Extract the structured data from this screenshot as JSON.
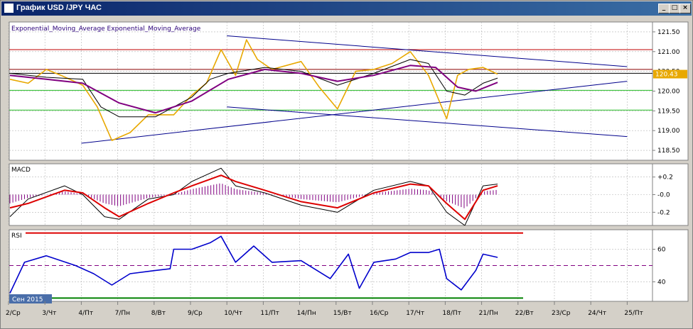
{
  "window": {
    "title": "График USD /JPY ЧАС",
    "minimize_glyph": "_",
    "maximize_glyph": "□",
    "close_glyph": "×"
  },
  "chart_data": [
    {
      "panel": "price",
      "type": "line",
      "legend_text": "Exponential_Moving_Average Exponential_Moving_Average",
      "y_ticks": [
        "121.50",
        "121.00",
        "120.50",
        "120.00",
        "119.50",
        "119.00",
        "118.50"
      ],
      "y_tick_values": [
        121.5,
        121.0,
        120.5,
        120.0,
        119.5,
        119.0,
        118.5
      ],
      "ylim": [
        118.25,
        121.75
      ],
      "current_price": "120.43",
      "x_ticks": [
        "2/Ср",
        "3/Чт",
        "4/Пт",
        "7/Пн",
        "8/Вт",
        "9/Ср",
        "10/Чт",
        "11/Пт",
        "14/Пн",
        "15/Вт",
        "16/Ср",
        "17/Чт",
        "18/Пт",
        "21/Пн",
        "22/Вт",
        "23/Ср",
        "24/Чт",
        "25/Пт"
      ],
      "date_badge": "Сен 2015",
      "horizontal_lines": [
        {
          "value": 121.05,
          "color": "#c00000"
        },
        {
          "value": 120.55,
          "color": "#8b0000"
        },
        {
          "value": 120.45,
          "color": "#000000"
        },
        {
          "value": 120.02,
          "color": "#22bb22"
        },
        {
          "value": 119.52,
          "color": "#22bb22"
        }
      ],
      "trend_lines": [
        {
          "from": [
            "10/Чт",
            121.4
          ],
          "to": [
            "25/Пт",
            120.62
          ],
          "color": "#00008b"
        },
        {
          "from": [
            "4/Пт",
            118.68
          ],
          "to": [
            "25/Пт",
            120.25
          ],
          "color": "#00008b"
        },
        {
          "from": [
            "10/Чт",
            119.6
          ],
          "to": [
            "25/Пт",
            118.85
          ],
          "color": "#00008b"
        }
      ],
      "series": [
        {
          "color": "#e8a800",
          "points": [
            [
              0,
              120.3
            ],
            [
              0.5,
              120.2
            ],
            [
              1,
              120.55
            ],
            [
              1.4,
              120.4
            ],
            [
              2,
              120.15
            ],
            [
              2.4,
              119.6
            ],
            [
              2.8,
              118.75
            ],
            [
              3.3,
              118.95
            ],
            [
              3.8,
              119.4
            ],
            [
              4.5,
              119.4
            ],
            [
              5,
              119.9
            ],
            [
              5.4,
              120.2
            ],
            [
              5.8,
              121.05
            ],
            [
              6.2,
              120.4
            ],
            [
              6.5,
              121.3
            ],
            [
              6.8,
              120.8
            ],
            [
              7.2,
              120.55
            ],
            [
              8,
              120.75
            ],
            [
              8.5,
              120.1
            ],
            [
              9,
              119.55
            ],
            [
              9.5,
              120.5
            ],
            [
              10,
              120.55
            ],
            [
              10.5,
              120.7
            ],
            [
              11,
              121.0
            ],
            [
              11.5,
              120.4
            ],
            [
              12,
              119.3
            ],
            [
              12.3,
              120.4
            ],
            [
              12.6,
              120.55
            ],
            [
              13,
              120.6
            ],
            [
              13.4,
              120.43
            ]
          ]
        },
        {
          "color": "#000000",
          "points": [
            [
              0,
              120.45
            ],
            [
              1,
              120.35
            ],
            [
              2,
              120.3
            ],
            [
              2.5,
              119.6
            ],
            [
              3,
              119.35
            ],
            [
              4,
              119.35
            ],
            [
              5,
              119.85
            ],
            [
              5.5,
              120.3
            ],
            [
              6,
              120.45
            ],
            [
              7,
              120.6
            ],
            [
              8,
              120.5
            ],
            [
              9,
              120.15
            ],
            [
              10,
              120.45
            ],
            [
              11,
              120.8
            ],
            [
              11.5,
              120.7
            ],
            [
              12,
              120.0
            ],
            [
              12.5,
              119.9
            ],
            [
              13,
              120.2
            ],
            [
              13.4,
              120.33
            ]
          ]
        },
        {
          "color": "#800080",
          "points": [
            [
              0,
              120.4
            ],
            [
              1,
              120.3
            ],
            [
              2,
              120.2
            ],
            [
              3,
              119.7
            ],
            [
              4,
              119.45
            ],
            [
              5,
              119.75
            ],
            [
              6,
              120.3
            ],
            [
              7,
              120.55
            ],
            [
              8,
              120.45
            ],
            [
              9,
              120.25
            ],
            [
              10,
              120.4
            ],
            [
              11,
              120.65
            ],
            [
              11.7,
              120.6
            ],
            [
              12.3,
              120.1
            ],
            [
              12.8,
              120.0
            ],
            [
              13.4,
              120.22
            ]
          ]
        }
      ]
    },
    {
      "panel": "macd",
      "type": "line",
      "label": "MACD",
      "y_ticks": [
        "+0.2",
        "-0.0",
        "-0.2"
      ],
      "y_tick_values": [
        0.2,
        0.0,
        -0.2
      ],
      "ylim": [
        -0.35,
        0.35
      ],
      "series": [
        {
          "color": "#000000",
          "points": [
            [
              0,
              -0.25
            ],
            [
              0.5,
              -0.05
            ],
            [
              1.5,
              0.1
            ],
            [
              2,
              0.0
            ],
            [
              2.6,
              -0.25
            ],
            [
              3,
              -0.28
            ],
            [
              3.8,
              -0.05
            ],
            [
              4.5,
              0.0
            ],
            [
              5,
              0.15
            ],
            [
              5.8,
              0.3
            ],
            [
              6.2,
              0.1
            ],
            [
              7,
              0.02
            ],
            [
              8,
              -0.12
            ],
            [
              9,
              -0.2
            ],
            [
              10,
              0.05
            ],
            [
              11,
              0.15
            ],
            [
              11.5,
              0.1
            ],
            [
              12,
              -0.2
            ],
            [
              12.5,
              -0.35
            ],
            [
              13,
              0.1
            ],
            [
              13.4,
              0.12
            ]
          ]
        },
        {
          "color": "#dd0000",
          "points": [
            [
              0,
              -0.15
            ],
            [
              0.5,
              -0.1
            ],
            [
              1.5,
              0.05
            ],
            [
              2,
              0.02
            ],
            [
              2.6,
              -0.15
            ],
            [
              3,
              -0.25
            ],
            [
              3.8,
              -0.1
            ],
            [
              4.5,
              0.02
            ],
            [
              5,
              0.1
            ],
            [
              5.8,
              0.22
            ],
            [
              6.2,
              0.15
            ],
            [
              7,
              0.05
            ],
            [
              8,
              -0.08
            ],
            [
              9,
              -0.15
            ],
            [
              10,
              0.02
            ],
            [
              11,
              0.12
            ],
            [
              11.5,
              0.1
            ],
            [
              12,
              -0.1
            ],
            [
              12.5,
              -0.28
            ],
            [
              13,
              0.05
            ],
            [
              13.4,
              0.1
            ]
          ]
        }
      ]
    },
    {
      "panel": "rsi",
      "type": "line",
      "label": "RSI",
      "y_ticks": [
        "60",
        "40"
      ],
      "y_tick_values": [
        60,
        40
      ],
      "ylim": [
        28,
        72
      ],
      "levels": [
        {
          "value": 70,
          "color": "#dd0000"
        },
        {
          "value": 50,
          "color": "#800080"
        },
        {
          "value": 30,
          "color": "#008000"
        }
      ],
      "series": [
        {
          "color": "#0000cc",
          "points": [
            [
              0,
              33
            ],
            [
              0.4,
              52
            ],
            [
              1,
              56
            ],
            [
              1.8,
              50
            ],
            [
              2.3,
              45
            ],
            [
              2.8,
              38
            ],
            [
              3.3,
              45
            ],
            [
              4,
              47
            ],
            [
              4.4,
              48
            ],
            [
              4.5,
              60
            ],
            [
              5,
              60
            ],
            [
              5.5,
              64
            ],
            [
              5.8,
              68
            ],
            [
              6.2,
              52
            ],
            [
              6.7,
              62
            ],
            [
              7.2,
              52
            ],
            [
              8,
              53
            ],
            [
              8.8,
              42
            ],
            [
              9.3,
              57
            ],
            [
              9.6,
              36
            ],
            [
              10,
              52
            ],
            [
              10.6,
              54
            ],
            [
              11,
              58
            ],
            [
              11.5,
              58
            ],
            [
              11.8,
              60
            ],
            [
              12,
              42
            ],
            [
              12.4,
              35
            ],
            [
              12.8,
              47
            ],
            [
              13,
              57
            ],
            [
              13.4,
              55
            ]
          ]
        }
      ]
    }
  ]
}
